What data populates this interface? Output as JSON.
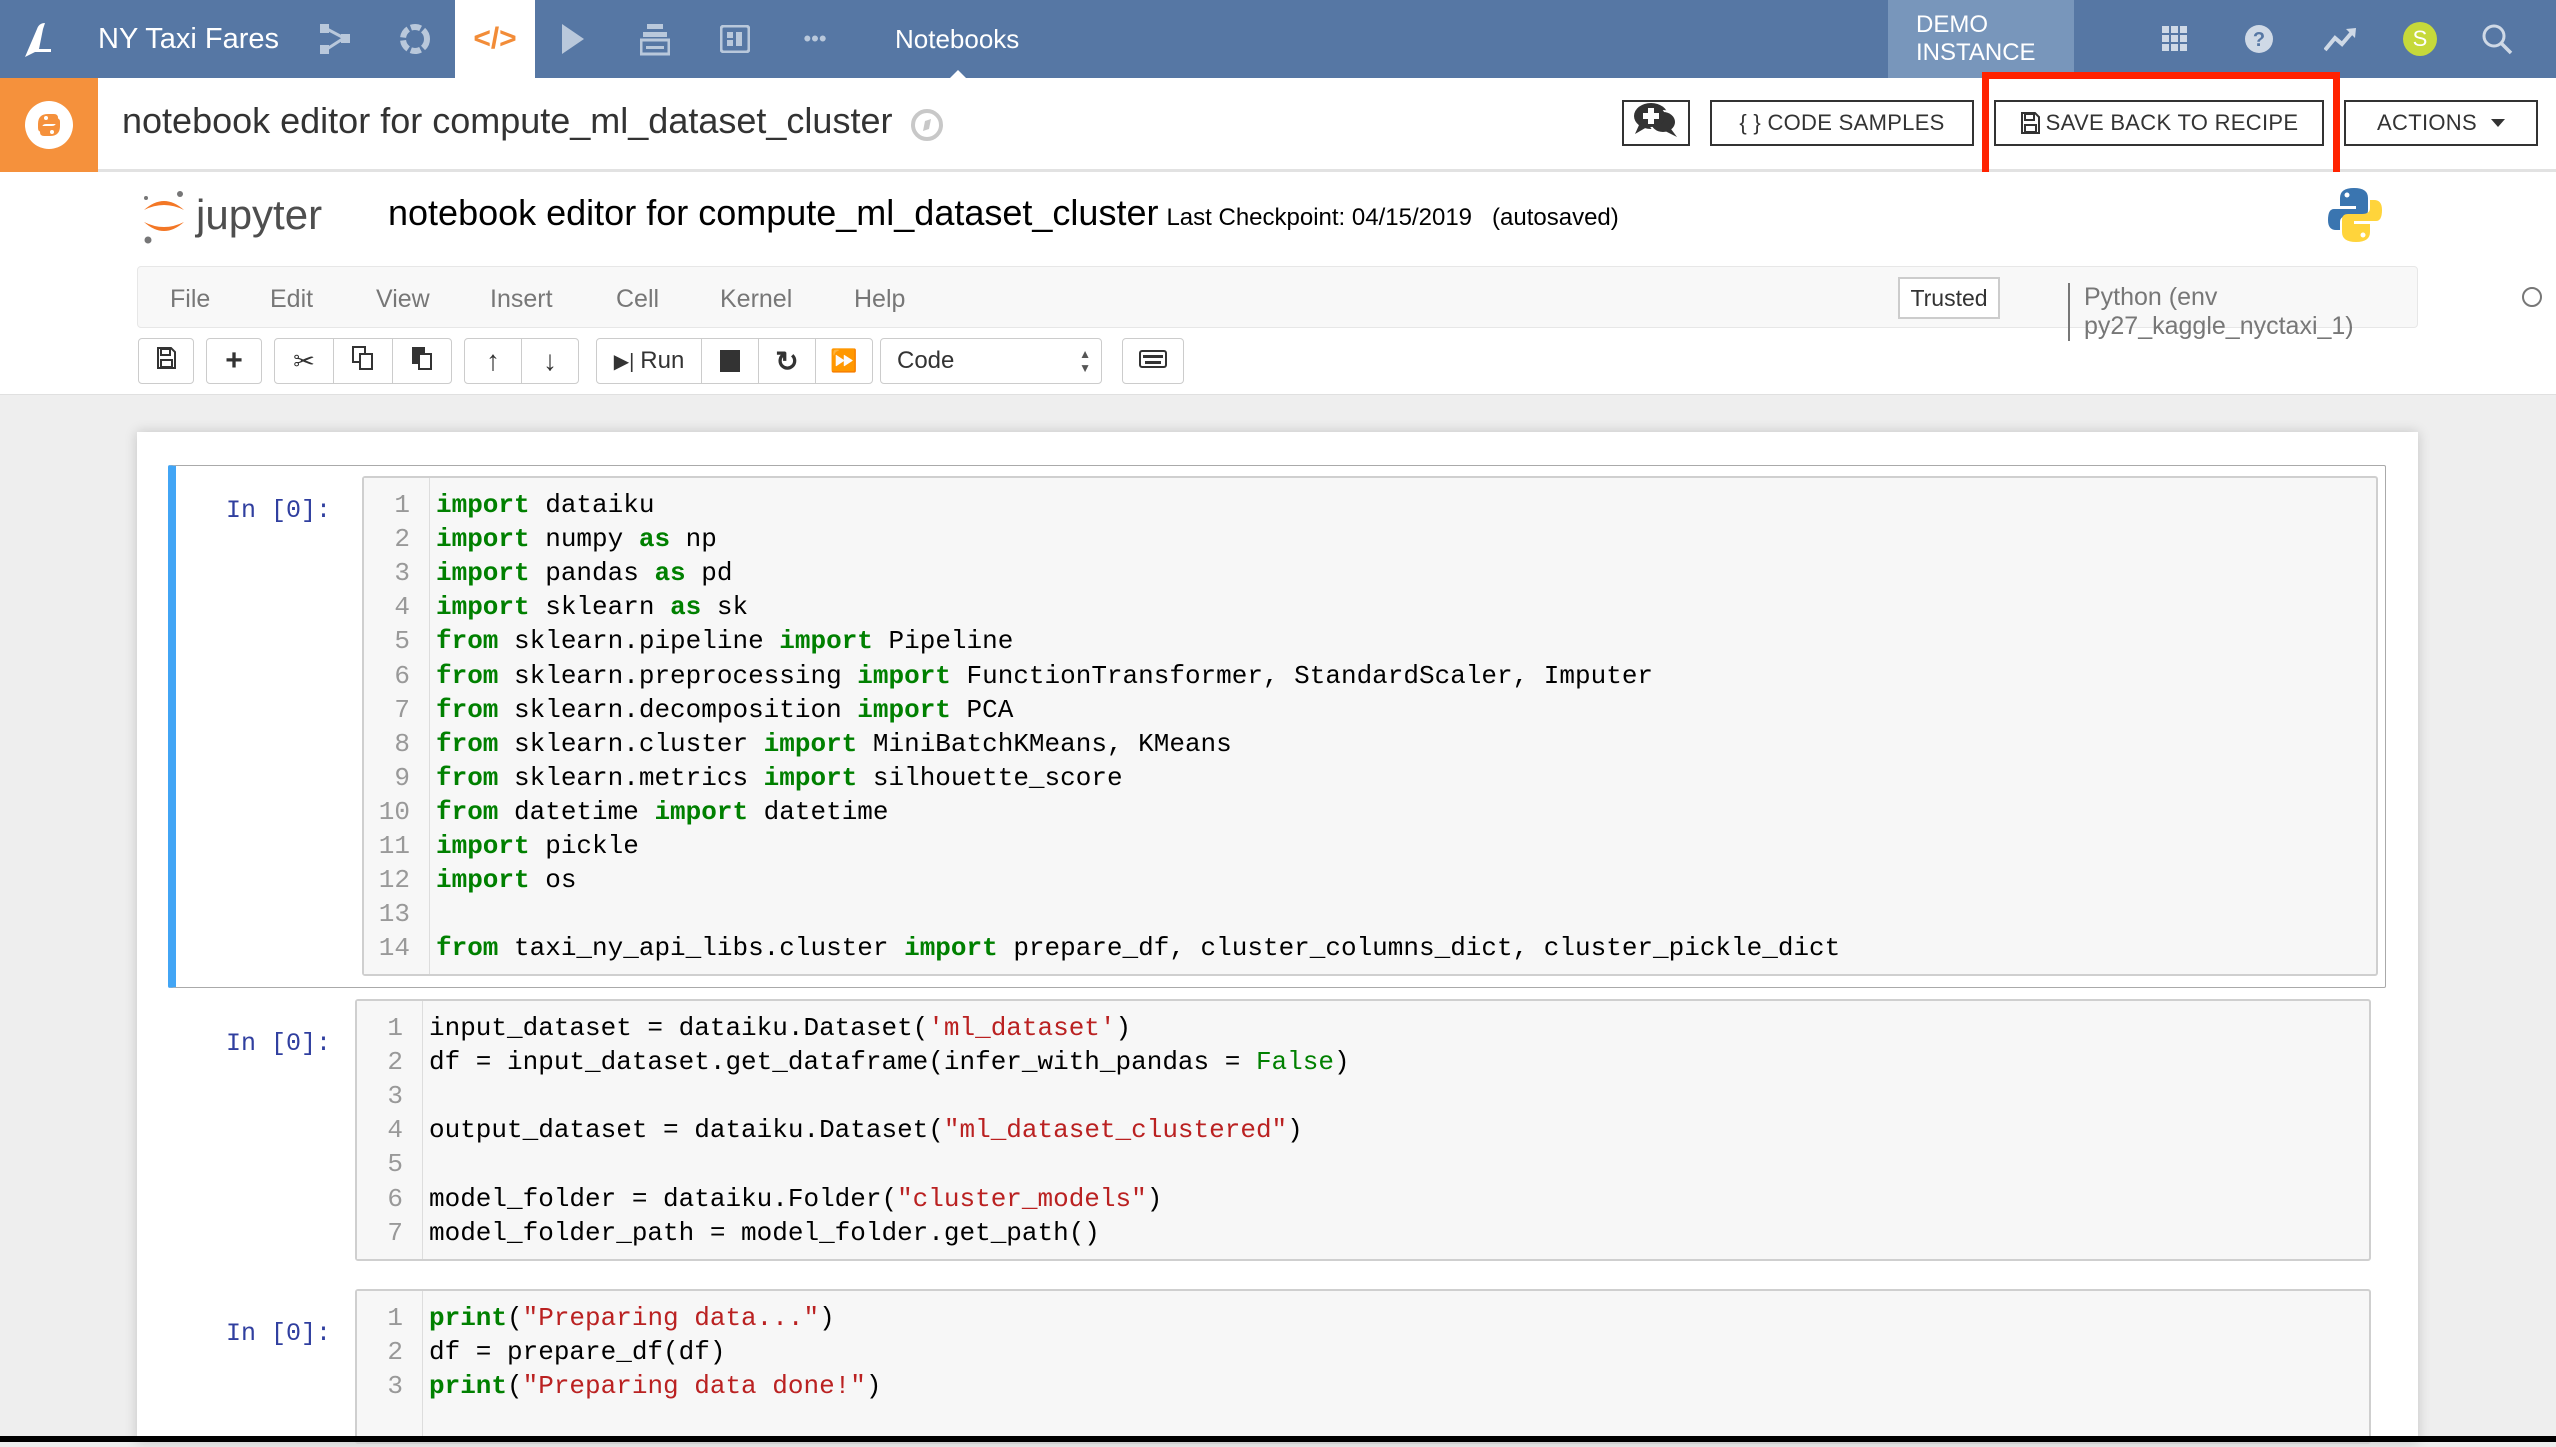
{
  "topnav": {
    "project": "NY Taxi Fares",
    "section": "Notebooks",
    "instance": "DEMO INSTANCE",
    "avatar_letter": "S",
    "icons": [
      "dataiku-bird-icon",
      "flow-icon",
      "lab-icon",
      "code-icon",
      "run-icon",
      "jobs-icon",
      "dashboard-icon",
      "more-icon",
      "apps-grid-icon",
      "help-icon",
      "activity-icon",
      "avatar",
      "search-icon"
    ]
  },
  "subheader": {
    "title": "notebook editor for compute_ml_dataset_cluster",
    "discussion_label": "",
    "code_samples_label": "{ } CODE SAMPLES",
    "save_back_label": "SAVE BACK TO RECIPE",
    "actions_label": "ACTIONS"
  },
  "jupyter": {
    "logo_text": "jupyter",
    "notebook_name": "notebook editor for compute_ml_dataset_cluster",
    "checkpoint": "Last Checkpoint: 04/15/2019",
    "autosaved": "(autosaved)",
    "menus": [
      "File",
      "Edit",
      "View",
      "Insert",
      "Cell",
      "Kernel",
      "Help"
    ],
    "trusted": "Trusted",
    "kernel": "Python (env py27_kaggle_nyctaxi_1)",
    "run_label": "Run",
    "cell_type": "Code"
  },
  "cells": [
    {
      "prompt": "In [0]:",
      "lines": [
        [
          [
            "kw",
            "import"
          ],
          [
            "",
            "dataiku"
          ]
        ],
        [
          [
            "kw",
            "import"
          ],
          [
            "",
            " numpy "
          ],
          [
            "kw",
            "as"
          ],
          [
            "",
            " np"
          ]
        ],
        [
          [
            "kw",
            "import"
          ],
          [
            "",
            " pandas "
          ],
          [
            "kw",
            "as"
          ],
          [
            "",
            " pd"
          ]
        ],
        [
          [
            "kw",
            "import"
          ],
          [
            "",
            " sklearn "
          ],
          [
            "kw",
            "as"
          ],
          [
            "",
            " sk"
          ]
        ],
        [
          [
            "kw",
            "from"
          ],
          [
            "",
            " sklearn.pipeline "
          ],
          [
            "kw",
            "import"
          ],
          [
            "",
            " Pipeline"
          ]
        ],
        [
          [
            "kw",
            "from"
          ],
          [
            "",
            " sklearn.preprocessing "
          ],
          [
            "kw",
            "import"
          ],
          [
            "",
            " FunctionTransformer, StandardScaler, Imputer"
          ]
        ],
        [
          [
            "kw",
            "from"
          ],
          [
            "",
            " sklearn.decomposition "
          ],
          [
            "kw",
            "import"
          ],
          [
            "",
            " PCA"
          ]
        ],
        [
          [
            "kw",
            "from"
          ],
          [
            "",
            " sklearn.cluster "
          ],
          [
            "kw",
            "import"
          ],
          [
            "",
            " MiniBatchKMeans, KMeans"
          ]
        ],
        [
          [
            "kw",
            "from"
          ],
          [
            "",
            " sklearn.metrics "
          ],
          [
            "kw",
            "import"
          ],
          [
            "",
            " silhouette_score"
          ]
        ],
        [
          [
            "kw",
            "from"
          ],
          [
            "",
            " datetime "
          ],
          [
            "kw",
            "import"
          ],
          [
            "",
            " datetime"
          ]
        ],
        [
          [
            "kw",
            "import"
          ],
          [
            "",
            " pickle"
          ]
        ],
        [
          [
            "kw",
            "import"
          ],
          [
            "",
            " os"
          ]
        ],
        [],
        [
          [
            "kw",
            "from"
          ],
          [
            "",
            " taxi_ny_api_libs.cluster "
          ],
          [
            "kw",
            "import"
          ],
          [
            "",
            " prepare_df, cluster_columns_dict, cluster_pickle_dict"
          ]
        ]
      ]
    },
    {
      "prompt": "In [0]:",
      "lines": [
        [
          [
            "",
            "input_dataset = dataiku.Dataset("
          ],
          [
            "st",
            "'ml_dataset'"
          ],
          [
            "",
            ")"
          ]
        ],
        [
          [
            "",
            "df = input_dataset.get_dataframe(infer_with_pandas = "
          ],
          [
            "bl",
            "False"
          ],
          [
            "",
            ")"
          ]
        ],
        [],
        [
          [
            "",
            "output_dataset = dataiku.Dataset("
          ],
          [
            "st",
            "\"ml_dataset_clustered\""
          ],
          [
            "",
            ")"
          ]
        ],
        [],
        [
          [
            "",
            "model_folder = dataiku.Folder("
          ],
          [
            "st",
            "\"cluster_models\""
          ],
          [
            "",
            ")"
          ]
        ],
        [
          [
            "",
            "model_folder_path = model_folder.get_path()"
          ]
        ]
      ]
    },
    {
      "prompt": "In [0]:",
      "lines": [
        [
          [
            "kw",
            "print"
          ],
          [
            "",
            "("
          ],
          [
            "st",
            "\"Preparing data...\""
          ],
          [
            "",
            ")"
          ]
        ],
        [
          [
            "",
            "df = prepare_df(df)"
          ]
        ],
        [
          [
            "kw",
            "print"
          ],
          [
            "",
            "("
          ],
          [
            "st",
            "\"Preparing data done!\""
          ],
          [
            "",
            ")"
          ]
        ]
      ]
    }
  ],
  "colors": {
    "nav": "#5677a4",
    "accent_orange": "#f5913c",
    "highlight_red": "#ff2200",
    "selected_cell": "#42a5f5"
  }
}
